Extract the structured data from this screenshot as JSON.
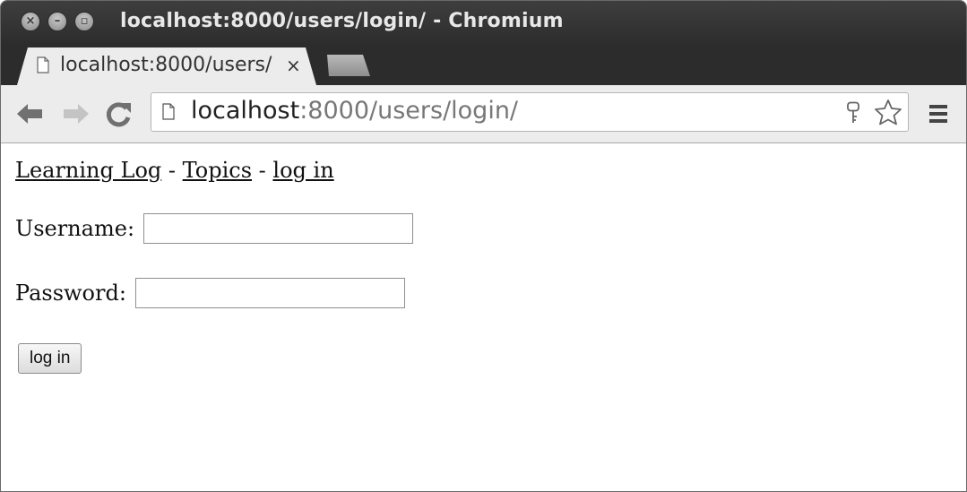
{
  "window": {
    "title": "localhost:8000/users/login/ - Chromium",
    "close_icon": "×",
    "minimize_icon": "–",
    "maximize_icon": "▫"
  },
  "tab": {
    "title": "localhost:8000/users/",
    "close_icon": "×"
  },
  "toolbar": {
    "url_host": "localhost",
    "url_rest": ":8000/users/login/",
    "icons": [
      "back-arrow-icon",
      "forward-arrow-icon",
      "reload-icon",
      "page-icon",
      "key-icon",
      "star-icon",
      "menu-icon"
    ]
  },
  "page": {
    "nav": {
      "site_link": "Learning Log",
      "sep1": " - ",
      "topics_link": "Topics",
      "sep2": " - ",
      "login_link": "log in"
    },
    "form": {
      "username_label": "Username:",
      "username_value": "",
      "password_label": "Password:",
      "password_value": "",
      "submit_label": "log in"
    }
  }
}
